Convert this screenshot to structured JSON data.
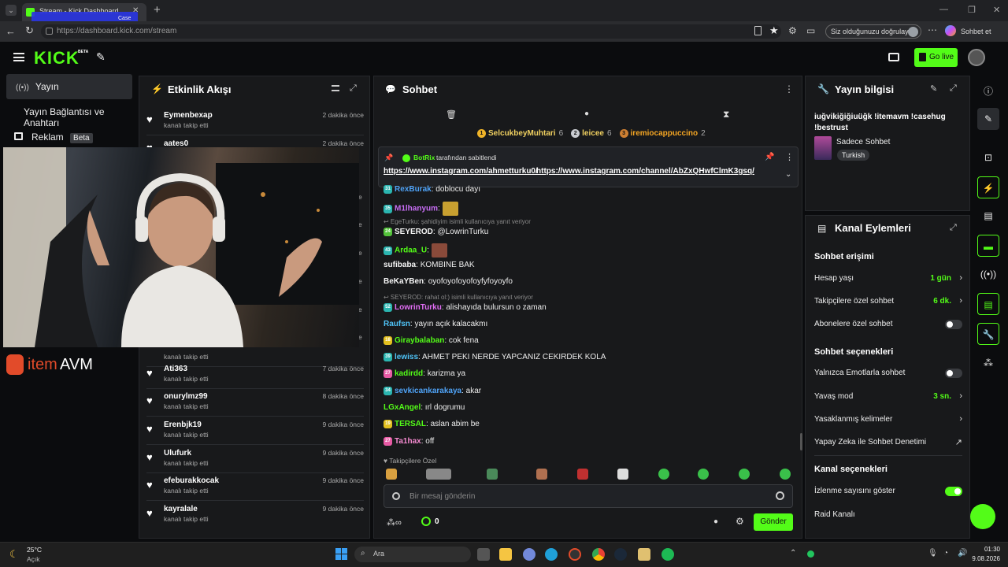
{
  "browser": {
    "tab_title": "Stream - Kick Dashboard",
    "tab_overlay": "Case",
    "url": "https://dashboard.kick.com/stream",
    "verify_label": "Siz olduğunuzu doğrulayın",
    "copilot_label": "Sohbet et"
  },
  "header": {
    "logo": "KICK",
    "logo_badge": "BETA",
    "go_live": "Go live"
  },
  "sidebar": {
    "items": [
      {
        "label": "Yayın"
      },
      {
        "label": "Yayın Bağlantısı ve Anahtarı"
      },
      {
        "label": "Reklam",
        "badge": "Beta"
      }
    ]
  },
  "overlay": {
    "brand_item": "item",
    "brand_avm": "AVM"
  },
  "activity": {
    "title": "Etkinlik Akışı",
    "items": [
      {
        "name": "Eymenbexap",
        "sub": "kanalı takip etti",
        "time": "2 dakika önce"
      },
      {
        "name": "aates0",
        "sub": "kanalı takip etti",
        "time": "2 dakika önce"
      },
      {
        "name": "",
        "sub": "kanalı takip etti",
        "time": ""
      },
      {
        "name": "Ati363",
        "sub": "kanalı takip etti",
        "time": "7 dakika önce"
      },
      {
        "name": "onurylmz99",
        "sub": "kanalı takip etti",
        "time": "8 dakika önce"
      },
      {
        "name": "Erenbjk19",
        "sub": "kanalı takip etti",
        "time": "9 dakika önce"
      },
      {
        "name": "Ulufurk",
        "sub": "kanalı takip etti",
        "time": "9 dakika önce"
      },
      {
        "name": "efeburakkocak",
        "sub": "kanalı takip etti",
        "time": "9 dakika önce"
      },
      {
        "name": "kayralale",
        "sub": "kanalı takip etti",
        "time": "9 dakika önce"
      }
    ],
    "side_letters": [
      "e",
      "e",
      "e",
      "e",
      "e",
      "e",
      "e"
    ]
  },
  "chat": {
    "title": "Sohbet",
    "leaders": [
      {
        "rank": "1",
        "name": "SelcukbeyMuhtari",
        "count": "6",
        "color": "#f0b429"
      },
      {
        "rank": "2",
        "name": "leicee",
        "count": "6",
        "color": "#c9ccd1"
      },
      {
        "rank": "3",
        "name": "iremiocappuccino",
        "count": "2",
        "color": "#cd7f32"
      }
    ],
    "pinned": {
      "by_user": "BotRix",
      "by_text": "tarafından sabitlendi",
      "link1": "https://www.instagram.com/ahmetturku0/",
      "link2": "https://www.instagram.com/channel/AbZxQHwfClmK3gsq/"
    },
    "messages": [
      {
        "badge": "31",
        "badge_color": "#2bb5b0",
        "user": "RexBurak",
        "color": "#4fa3f7",
        "text": "doblocu dayı"
      },
      {
        "badge": "35",
        "badge_color": "#2bb5b0",
        "user": "M1lhanyum",
        "color": "#c86ef5",
        "text": ""
      },
      {
        "reply": "EgeTurku: şahidiyim isimli kullanıcıya yanıt veriyor"
      },
      {
        "badge": "24",
        "badge_color": "#53c23a",
        "user": "SEYEROD",
        "color": "#f5f5f5",
        "text": "@LowrinTurku"
      },
      {
        "badge": "43",
        "badge_color": "#2bb5b0",
        "user": "Ardaa_U",
        "color": "#53fc18",
        "text": ""
      },
      {
        "badge": "",
        "badge_color": "",
        "user": "sufibaba",
        "color": "#f5f5f5",
        "text": "KOMBINE BAK"
      },
      {
        "badge": "",
        "badge_color": "",
        "user": "BeKaYBen",
        "color": "#f5f5f5",
        "text": "oyofoyofoyofoyfyfoyoyfo"
      },
      {
        "reply": "SEYEROD: rahat ol:) isimli kullanıcıya yanıt veriyor"
      },
      {
        "badge": "52",
        "badge_color": "#2bb5b0",
        "user": "LowrinTurku",
        "color": "#e26ef5",
        "text": "alishayıda bulursun o zaman"
      },
      {
        "badge": "",
        "badge_color": "",
        "user": "Raufsn",
        "color": "#4fc3f7",
        "text": "yayın açık kalacakmı"
      },
      {
        "badge": "18",
        "badge_color": "#e3c020",
        "user": "Giraybalaban",
        "color": "#53fc18",
        "text": "cok fena"
      },
      {
        "badge": "39",
        "badge_color": "#2bb5b0",
        "user": "lewiss",
        "color": "#4fc3f7",
        "text": "AHMET PEKI NERDE YAPCANIZ CEKIRDEK KOLA"
      },
      {
        "badge": "27",
        "badge_color": "#e85aa5",
        "user": "kadirdd",
        "color": "#53fc18",
        "text": "karizma ya"
      },
      {
        "badge": "34",
        "badge_color": "#2bb5b0",
        "user": "sevkicankarakaya",
        "color": "#4fa3f7",
        "text": "akar"
      },
      {
        "badge": "",
        "badge_color": "",
        "user": "LGxAngel",
        "color": "#53fc18",
        "text": "ırl dogrumu"
      },
      {
        "badge": "19",
        "badge_color": "#e3c020",
        "user": "TERSAL",
        "color": "#53fc18",
        "text": "aslan abim be"
      },
      {
        "badge": "27",
        "badge_color": "#e85aa5",
        "user": "Ta1hax",
        "color": "#f58ad0",
        "text": "off"
      }
    ],
    "followers_only": "Takipçilere Özel",
    "input_placeholder": "Bir mesaj gönderin",
    "points": "0",
    "send": "Gönder"
  },
  "stream_info": {
    "title": "Yayın bilgisi",
    "stream_title": "iuğvikiğiğiuüğk !itemavm !casehug !bestrust",
    "category": "Sadece Sohbet",
    "tag": "Turkish"
  },
  "channel_actions": {
    "title": "Kanal Eylemleri",
    "chat_access": "Sohbet erişimi",
    "account_age": {
      "label": "Hesap yaşı",
      "value": "1 gün"
    },
    "followers_chat": {
      "label": "Takipçilere özel sohbet",
      "value": "6 dk."
    },
    "subs_chat": {
      "label": "Abonelere özel sohbet",
      "on": false
    },
    "chat_options": "Sohbet seçenekleri",
    "emote_only": {
      "label": "Yalnızca Emotlarla sohbet",
      "on": false
    },
    "slow_mode": {
      "label": "Yavaş mod",
      "value": "3 sn."
    },
    "banned_words": {
      "label": "Yasaklanmış kelimeler"
    },
    "ai_moderation": {
      "label": "Yapay Zeka ile Sohbet Denetimi"
    },
    "channel_options": "Kanal seçenekleri",
    "show_viewers": {
      "label": "İzlenme sayısını göster",
      "on": true
    },
    "raid": {
      "label": "Raid Kanalı"
    }
  },
  "taskbar": {
    "weather_temp": "25°C",
    "weather_desc": "Açık",
    "search": "Ara",
    "time": "01:30",
    "date": "9.08.2026"
  },
  "colors": {
    "accent": "#53fc18",
    "bg": "#0b0c0e",
    "panel": "#18191b"
  }
}
